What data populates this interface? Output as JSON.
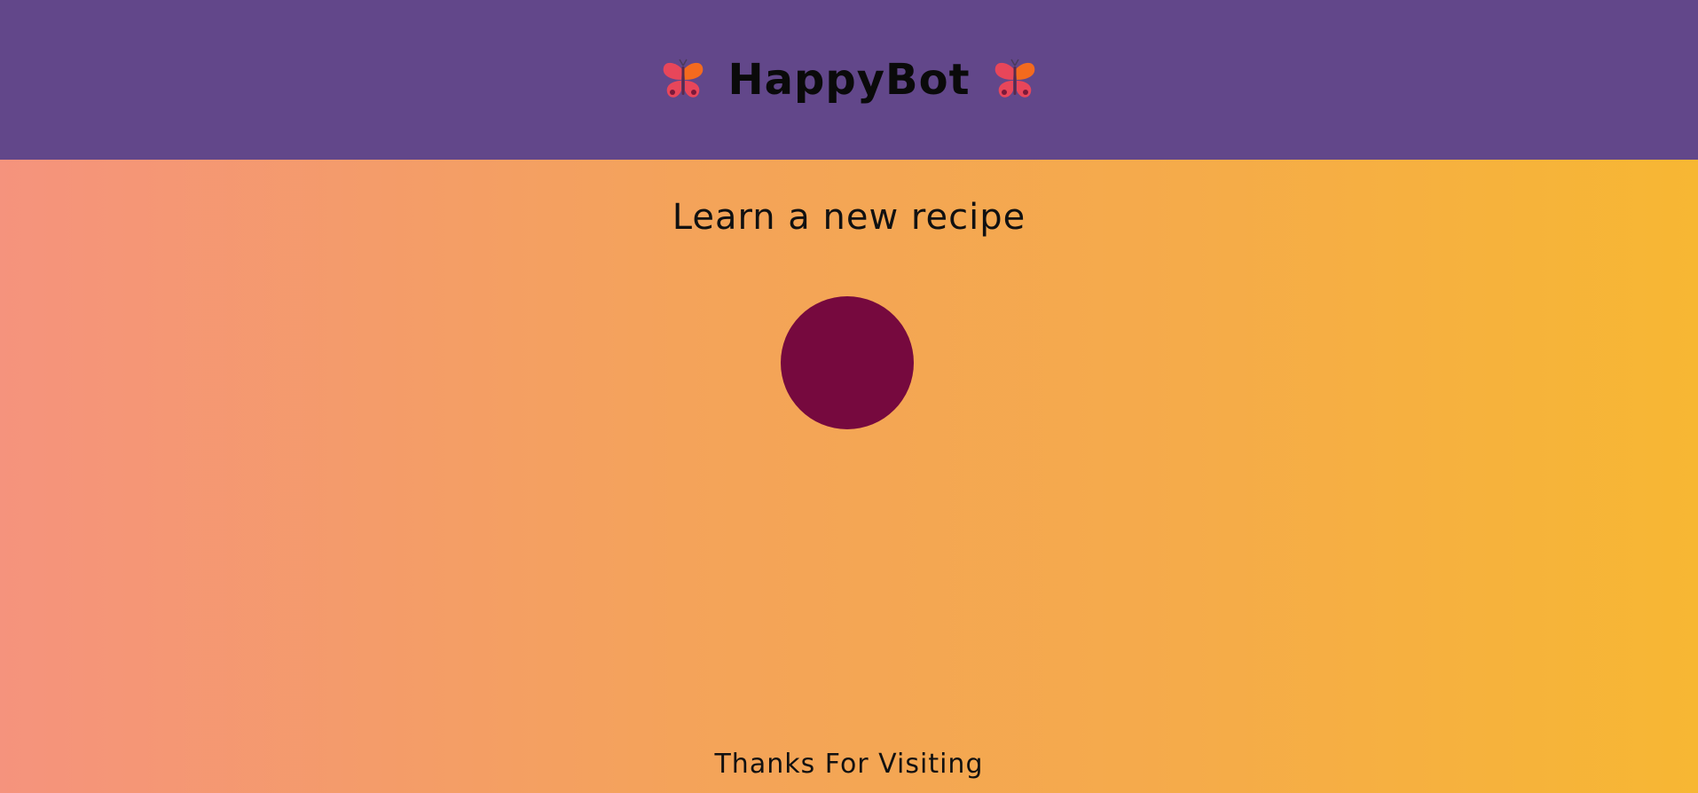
{
  "header": {
    "title": "HappyBot",
    "left_icon": "butterfly-icon",
    "right_icon": "butterfly-icon",
    "background": "#62478a"
  },
  "main": {
    "heading": "Learn a new recipe",
    "button_color": "#76093e"
  },
  "footer": {
    "text": "Thanks For Visiting"
  },
  "colors": {
    "gradient_start": "#f5937d",
    "gradient_end": "#f7b733"
  }
}
